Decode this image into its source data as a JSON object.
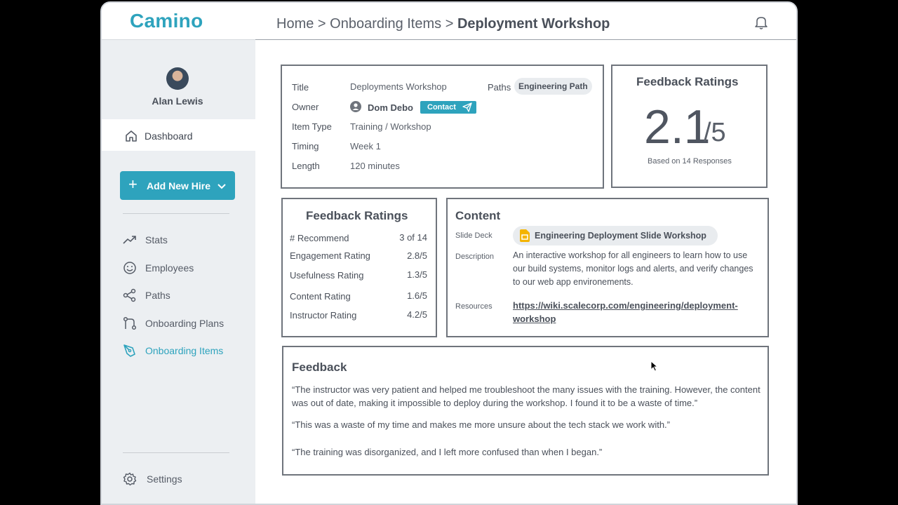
{
  "app": {
    "logo": "Camino"
  },
  "sidebar": {
    "user_name": "Alan Lewis",
    "dashboard": "Dashboard",
    "add_button": "Add New Hire",
    "items": [
      {
        "label": "Stats"
      },
      {
        "label": "Employees"
      },
      {
        "label": "Paths"
      },
      {
        "label": "Onboarding Plans"
      },
      {
        "label": "Onboarding Items"
      }
    ],
    "settings": "Settings"
  },
  "header": {
    "crumb_home": "Home",
    "sep": ">",
    "crumb_section": "Onboarding Items",
    "crumb_current": "Deployment Workshop"
  },
  "details": {
    "title_label": "Title",
    "title_value": "Deployments Workshop",
    "paths_label": "Paths",
    "paths_value": "Engineering Path",
    "owner_label": "Owner",
    "owner_value": "Dom Debo",
    "contact_label": "Contact",
    "type_label": "Item Type",
    "type_value": "Training / Workshop",
    "timing_label": "Timing",
    "timing_value": "Week 1",
    "length_label": "Length",
    "length_value": "120 minutes"
  },
  "summary": {
    "title": "Feedback Ratings",
    "score": "2.1",
    "denominator": "/5",
    "based_on": "Based on 14 Responses"
  },
  "ratings": {
    "title": "Feedback Ratings",
    "rows": [
      {
        "label": "# Recommend",
        "value": "3 of 14"
      },
      {
        "label": "Engagement Rating",
        "value": "2.8/5"
      },
      {
        "label": "Usefulness Rating",
        "value": "1.3/5"
      },
      {
        "label": "Content Rating",
        "value": "1.6/5"
      },
      {
        "label": "Instructor Rating",
        "value": "4.2/5"
      }
    ]
  },
  "content": {
    "title": "Content",
    "slide_label": "Slide Deck",
    "slide_value": "Engineering Deployment Slide Workshop",
    "desc_label": "Description",
    "desc_value": "An interactive workshop for all engineers to learn how to use our build systems, monitor logs and alerts, and verify changes to our web app environements.",
    "res_label": "Resources",
    "res_value": "https://wiki.scalecorp.com/engineering/deployment-workshop"
  },
  "feedback": {
    "title": "Feedback",
    "quotes": [
      "“The instructor was very patient and helped me troubleshoot the many issues with the training. However, the content was out of date, making it impossible to deploy during the workshop. I found it to be a waste of time.”",
      "“This was a waste of my time and makes me more unsure about the tech stack we work with.”",
      "“The training was disorganized, and I left more confused than when I began.”"
    ]
  },
  "colors": {
    "accent": "#2ea3bd",
    "border": "#6f747c",
    "sidebar_bg": "#eceff2"
  }
}
